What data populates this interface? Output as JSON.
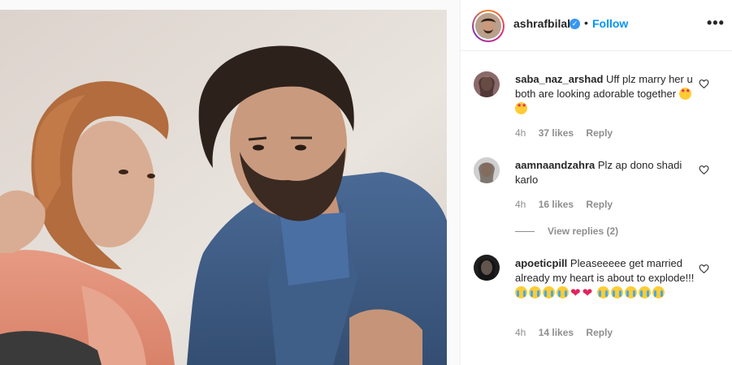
{
  "post": {
    "username": "ashrafbilal",
    "verified": true,
    "follow_label": "Follow",
    "more_label": "•••",
    "separator": "•"
  },
  "comments": [
    {
      "username": "saba_naz_arshad",
      "text": "Uff plz marry her u both are looking adorable together",
      "emojis": [
        "star-struck",
        "star-struck"
      ],
      "time": "4h",
      "likes": "37 likes",
      "reply": "Reply"
    },
    {
      "username": "aamnaandzahra",
      "text": "Plz ap dono shadi karlo",
      "emojis": [],
      "time": "4h",
      "likes": "16 likes",
      "reply": "Reply"
    },
    {
      "username": "apoeticpill",
      "text": "Pleaseeeee get married already my heart is about to explode!!!",
      "emojis": [
        "loudly-crying",
        "loudly-crying",
        "loudly-crying",
        "loudly-crying",
        "red-heart",
        "red-heart",
        "loudly-crying",
        "loudly-crying",
        "loudly-crying",
        "loudly-crying",
        "loudly-crying"
      ],
      "time": "4h",
      "likes": "14 likes",
      "reply": "Reply"
    }
  ],
  "view_replies": "View replies (2)",
  "icons": {
    "verified": "verified-badge-icon",
    "more": "more-options-icon",
    "like": "heart-outline-icon"
  },
  "colors": {
    "accent": "#0095f6",
    "verified": "#3897f0",
    "muted": "#8e8e8e"
  }
}
